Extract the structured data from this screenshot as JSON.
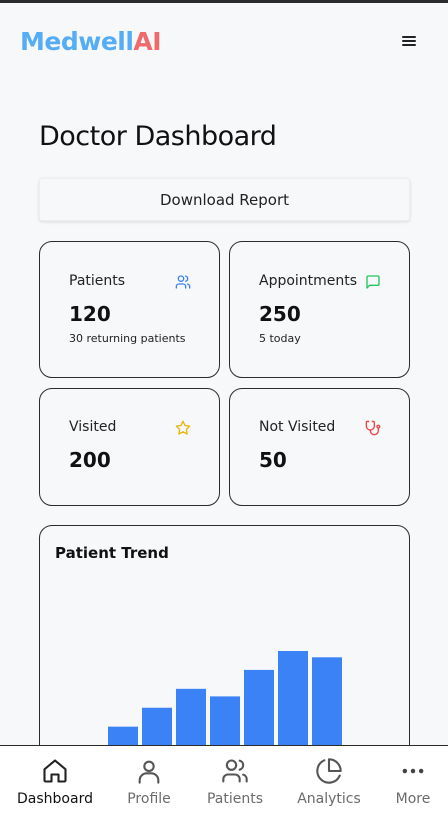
{
  "header": {
    "logo_part1": "Medwell",
    "logo_part2": "AI",
    "menu_icon": "hamburger-menu-icon"
  },
  "page": {
    "title": "Doctor Dashboard",
    "download_label": "Download Report"
  },
  "stats": {
    "patients": {
      "label": "Patients",
      "value": "120",
      "sub": "30 returning patients",
      "icon": "users-icon",
      "color": "#3b82f6"
    },
    "appointments": {
      "label": "Appointments",
      "value": "250",
      "sub": "5 today",
      "icon": "message-square-icon",
      "color": "#22c55e"
    },
    "visited": {
      "label": "Visited",
      "value": "200",
      "icon": "star-icon",
      "color": "#eab308"
    },
    "not_visited": {
      "label": "Not Visited",
      "value": "50",
      "icon": "stethoscope-icon",
      "color": "#ef4444"
    }
  },
  "chart_data": {
    "type": "bar",
    "title": "Patient Trend",
    "values": [
      55,
      70,
      85,
      79,
      100,
      115,
      110
    ],
    "color": "#3b82f6"
  },
  "nav": {
    "items": [
      {
        "label": "Dashboard",
        "icon": "home-icon"
      },
      {
        "label": "Profile",
        "icon": "user-icon"
      },
      {
        "label": "Patients",
        "icon": "users-icon"
      },
      {
        "label": "Analytics",
        "icon": "pie-chart-icon"
      },
      {
        "label": "More",
        "icon": "more-horizontal-icon"
      }
    ]
  }
}
